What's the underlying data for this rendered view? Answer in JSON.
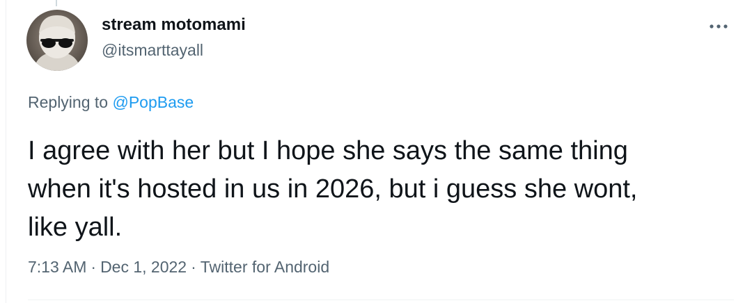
{
  "author": {
    "display_name": "stream motomami",
    "handle": "@itsmarttayall",
    "avatar_icon": "profile-avatar"
  },
  "more_icon": "ellipsis-icon",
  "reply": {
    "prefix": "Replying to ",
    "handle": "@PopBase"
  },
  "tweet": {
    "lines": [
      "I agree with her but I hope she says the same thing",
      "when it's hosted in us in 2026, but i guess she wont,",
      "like yall."
    ]
  },
  "meta": {
    "time": "7:13 AM",
    "date": "Dec 1, 2022",
    "source": "Twitter for Android",
    "separator": "·"
  },
  "colors": {
    "text_primary": "#0f1419",
    "text_secondary": "#536471",
    "link": "#1d9bf0",
    "divider": "#eff3f4"
  }
}
